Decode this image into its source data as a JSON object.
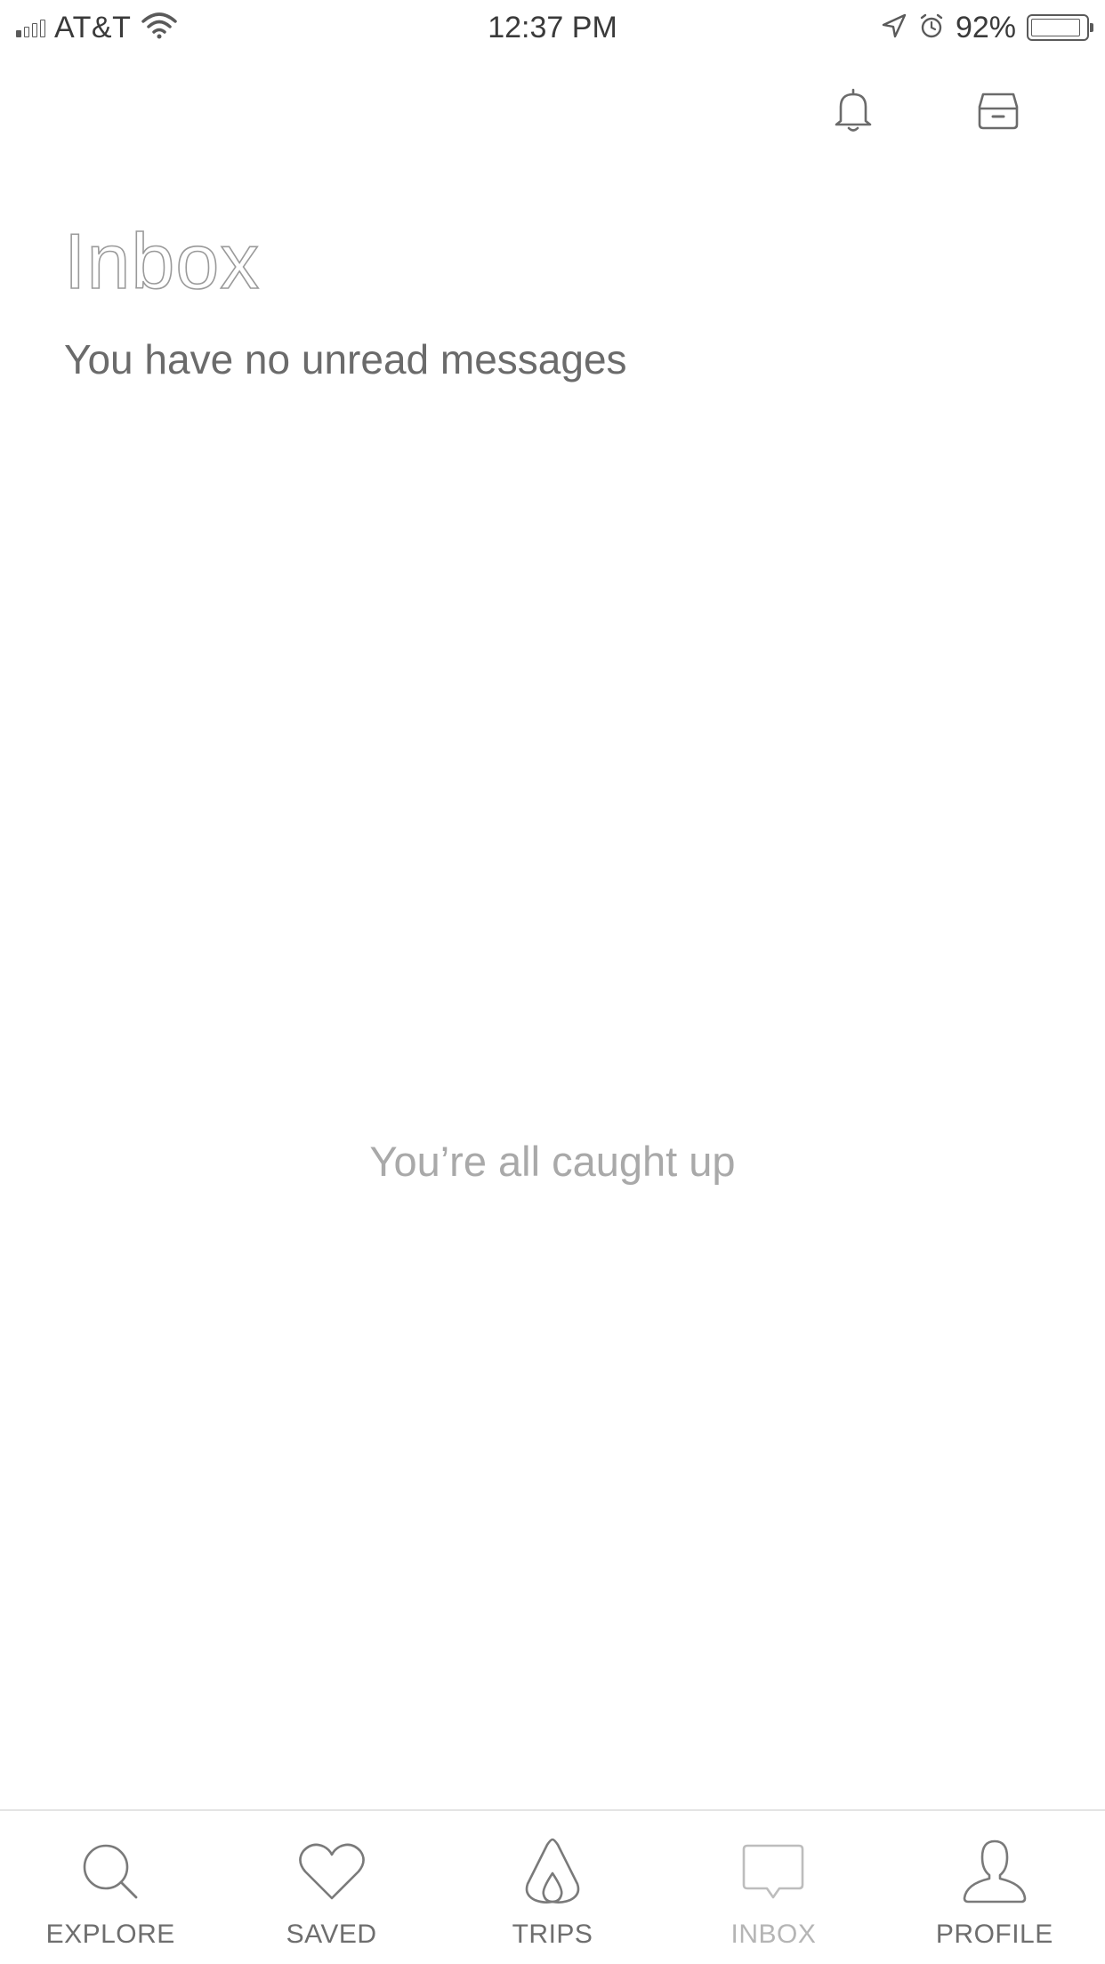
{
  "status_bar": {
    "carrier": "AT&T",
    "time": "12:37 PM",
    "battery_percent": "92%",
    "signal_bars_filled": 1,
    "icons": [
      "signal-icon",
      "wifi-icon",
      "location-arrow-icon",
      "alarm-icon",
      "battery-icon"
    ]
  },
  "top_actions": {
    "icons": [
      "bell-icon",
      "archive-icon"
    ]
  },
  "header": {
    "title": "Inbox",
    "subtitle": "You have no unread messages"
  },
  "empty_state": {
    "message": "You’re all caught up"
  },
  "tab_bar": {
    "active_tab": "INBOX",
    "tabs": [
      {
        "label": "EXPLORE",
        "icon": "search-icon"
      },
      {
        "label": "SAVED",
        "icon": "heart-icon"
      },
      {
        "label": "TRIPS",
        "icon": "airbnb-logo-icon"
      },
      {
        "label": "INBOX",
        "icon": "message-bubble-icon"
      },
      {
        "label": "PROFILE",
        "icon": "user-icon"
      }
    ]
  },
  "colors": {
    "text_primary": "#484848",
    "text_muted": "#a9a9a9",
    "tab_active": "#b5b5b5",
    "divider": "#e4e4e4",
    "background": "#ffffff"
  }
}
